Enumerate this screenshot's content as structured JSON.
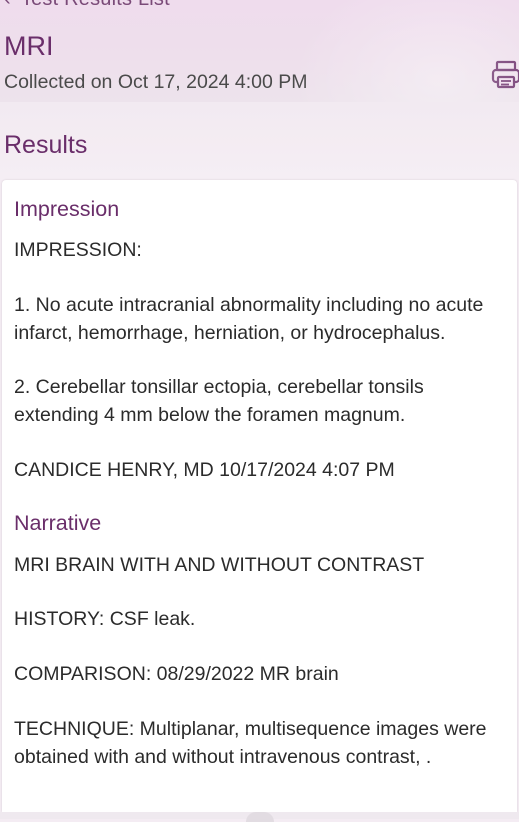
{
  "header": {
    "back_label": "Test Results List",
    "back_chevron": "‹",
    "title": "MRI",
    "collected": "Collected on Oct 17, 2024 4:00 PM",
    "print_icon": "printer-icon"
  },
  "results": {
    "heading": "Results"
  },
  "impression": {
    "title": "Impression",
    "label": "IMPRESSION:",
    "item1": "1. No acute intracranial abnormality including no acute infarct, hemorrhage, herniation, or hydrocephalus.",
    "item2": "2. Cerebellar tonsillar ectopia, cerebellar tonsils extending 4 mm below the foramen magnum.",
    "signature": "CANDICE HENRY, MD 10/17/2024 4:07 PM"
  },
  "narrative": {
    "title": "Narrative",
    "exam": "MRI BRAIN WITH AND WITHOUT CONTRAST",
    "history": "HISTORY: CSF leak.",
    "comparison": "COMPARISON: 08/29/2022 MR brain",
    "technique": "TECHNIQUE: Multiplanar, multisequence images were obtained with and without intravenous contrast, ."
  },
  "colors": {
    "accent": "#6a2e6a",
    "header_bg": "#efdced",
    "text": "#2b2b2b"
  }
}
